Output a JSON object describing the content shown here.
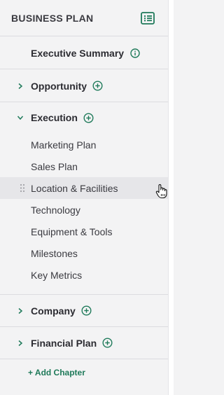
{
  "header": {
    "title": "BUSINESS PLAN",
    "outline_icon": "outline-list-icon"
  },
  "chapters": {
    "executive_summary": {
      "label": "Executive Summary",
      "icon": "info-icon"
    },
    "opportunity": {
      "label": "Opportunity",
      "expanded": false
    },
    "execution": {
      "label": "Execution",
      "expanded": true,
      "sections": [
        {
          "label": "Marketing Plan"
        },
        {
          "label": "Sales Plan"
        },
        {
          "label": "Location & Facilities",
          "active": true
        },
        {
          "label": "Technology"
        },
        {
          "label": "Equipment & Tools"
        },
        {
          "label": "Milestones"
        },
        {
          "label": "Key Metrics"
        }
      ]
    },
    "company": {
      "label": "Company",
      "expanded": false
    },
    "financial_plan": {
      "label": "Financial Plan",
      "expanded": false
    }
  },
  "add_chapter_label": "+ Add Chapter",
  "colors": {
    "accent": "#1f7a5a",
    "active_row": "#e6e6e9",
    "panel_bg": "#f3f3f4"
  }
}
